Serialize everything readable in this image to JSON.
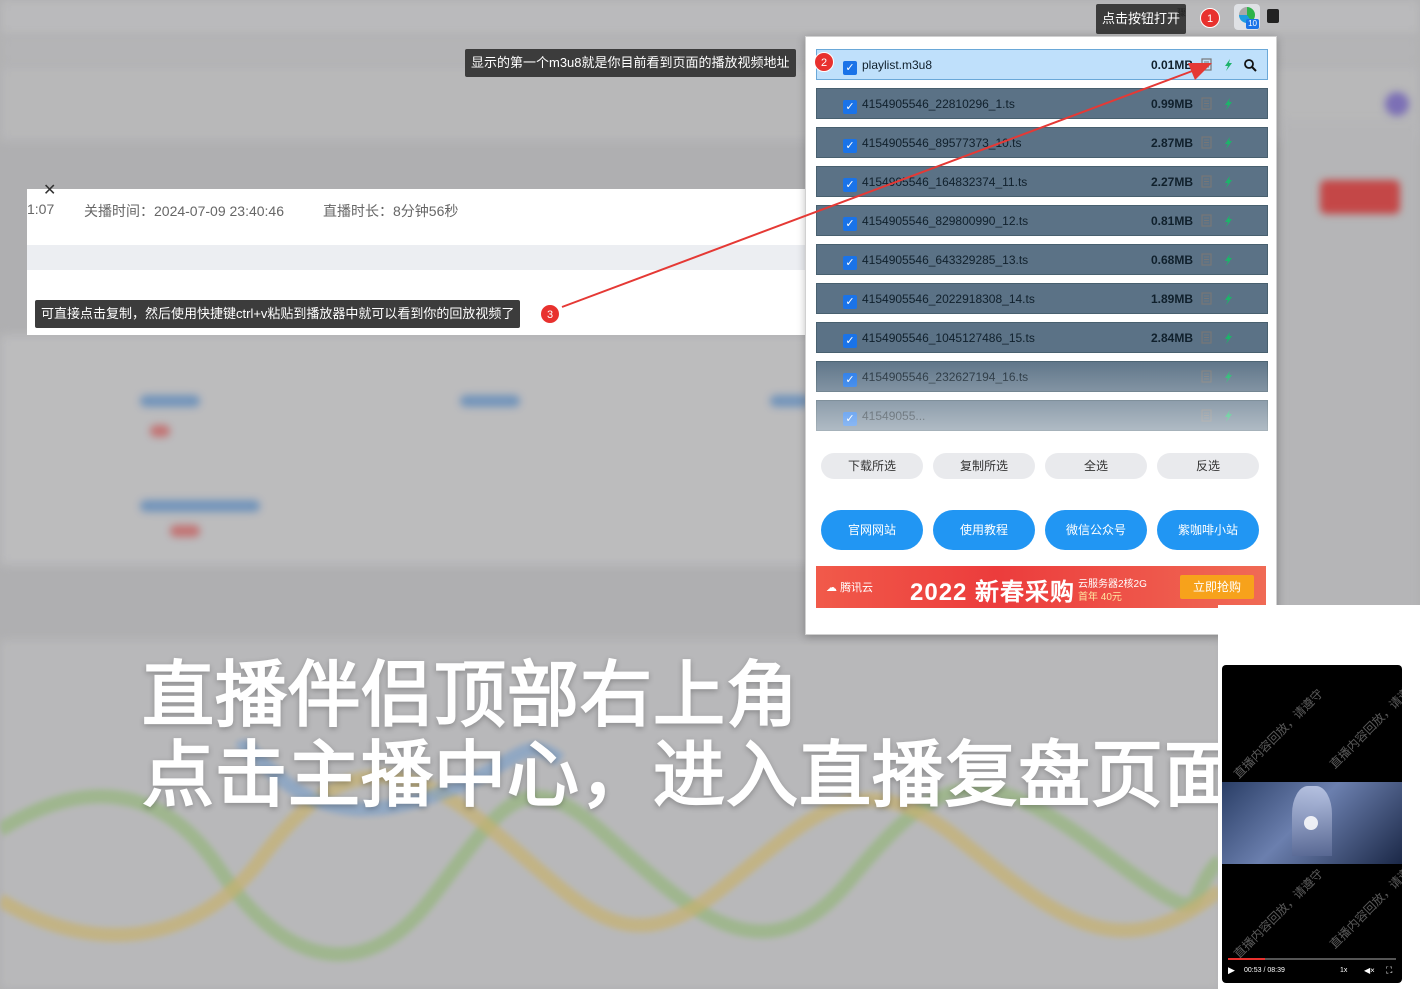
{
  "panel": {
    "time_fragment": "1:07",
    "close_time_label": "关播时间：2024-07-09 23:40:46",
    "duration_label": "直播时长：8分钟56秒"
  },
  "toolbar": {
    "open_tip": "点击按钮打开",
    "tiny_text": "骤",
    "ext_badge": "10"
  },
  "tooltips": {
    "step1_num": "1",
    "step2_num": "2",
    "step2_text": "显示的第一个m3u8就是你目前看到页面的播放视频地址",
    "step3_num": "3",
    "step3_text": "可直接点击复制，然后使用快捷键ctrl+v粘贴到播放器中就可以看到你的回放视频了"
  },
  "popup": {
    "files": [
      {
        "name": "playlist.m3u8",
        "size": "0.01MB",
        "first": true
      },
      {
        "name": "4154905546_22810296_1.ts",
        "size": "0.99MB"
      },
      {
        "name": "4154905546_89577373_10.ts",
        "size": "2.87MB"
      },
      {
        "name": "4154905546_164832374_11.ts",
        "size": "2.27MB"
      },
      {
        "name": "4154905546_829800990_12.ts",
        "size": "0.81MB"
      },
      {
        "name": "4154905546_643329285_13.ts",
        "size": "0.68MB"
      },
      {
        "name": "4154905546_2022918308_14.ts",
        "size": "1.89MB"
      },
      {
        "name": "4154905546_1045127486_15.ts",
        "size": "2.84MB"
      },
      {
        "name": "4154905546_232627194_16.ts",
        "size": ""
      },
      {
        "name": "41549055...",
        "size": ""
      }
    ],
    "actions": [
      "下载所选",
      "复制所选",
      "全选",
      "反选"
    ],
    "links": [
      "官网网站",
      "使用教程",
      "微信公众号",
      "紫咖啡小站"
    ],
    "ad": {
      "brand": "腾讯云",
      "title": "2022 新春采购",
      "sub1": "云服务器2核2G",
      "sub2": "首年 40元",
      "cta": "立即抢购"
    }
  },
  "caption": {
    "line1": "直播伴侣顶部右上角",
    "line2": "点击主播中心，进入直播复盘页面"
  },
  "video": {
    "watermark": "直播内容回放，请遵守",
    "time": "00:53 / 08:39",
    "speed": "1x",
    "progress": 0.22
  },
  "colors": {
    "row_selected": "#bfe0fb",
    "row_normal": "#5b7286",
    "button_blue": "#2196f3",
    "badge_red": "#e8312e",
    "arrow_red": "#e53935",
    "download_green": "#1db36a"
  }
}
